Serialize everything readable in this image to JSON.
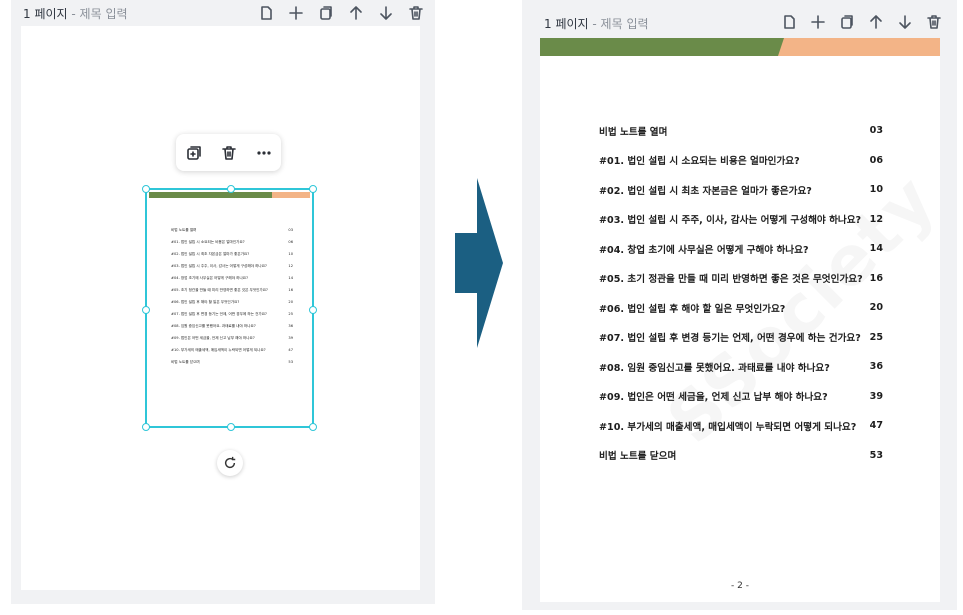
{
  "left": {
    "page_label": "1 페이지",
    "page_label_sep": " - ",
    "page_title_placeholder": "제목 입력",
    "toolbar_icons": [
      "page-icon",
      "add-icon",
      "duplicate-icon",
      "arrow-up-icon",
      "arrow-down-icon",
      "trash-icon"
    ],
    "context_toolbar_icons": [
      "duplicate-plus-icon",
      "trash-icon",
      "more-icon"
    ],
    "mini_toc": [
      {
        "title": "비법 노트를 열며",
        "page": "03"
      },
      {
        "title": "#01. 법인 설립 시 소요되는 비용은 얼마인가요?",
        "page": "06"
      },
      {
        "title": "#02. 법인 설립 시 최초 자본금은 얼마가 좋은가요?",
        "page": "10"
      },
      {
        "title": "#03. 법인 설립 시 주주, 이사, 감사는 어떻게 구성해야 하나요?",
        "page": "12"
      },
      {
        "title": "#04. 창업 초기에 사무실은 어떻게 구해야 하나요?",
        "page": "14"
      },
      {
        "title": "#05. 초기 정관을 만들 때 미리 반영하면 좋은 것은 무엇인가요?",
        "page": "16"
      },
      {
        "title": "#06. 법인 설립 후 해야 할 일은 무엇인가요?",
        "page": "20"
      },
      {
        "title": "#07. 법인 설립 후 변경 등기는 언제, 어떤 경우에 하는 건가요?",
        "page": "25"
      },
      {
        "title": "#08. 임원 중임신고를 못했어요. 과태료를 내야 하나요?",
        "page": "36"
      },
      {
        "title": "#09. 법인은 어떤 세금을, 언제 신고 납부 해야 하나요?",
        "page": "39"
      },
      {
        "title": "#10. 부가세의 매출세액, 매입세액이 누락되면 어떻게 되나요?",
        "page": "47"
      },
      {
        "title": "비법 노트를 닫으며",
        "page": "53"
      }
    ]
  },
  "right": {
    "page_label": "1 페이지",
    "page_label_sep": " - ",
    "page_title_placeholder": "제목 입력",
    "toolbar_icons": [
      "page-icon",
      "add-icon",
      "duplicate-icon",
      "arrow-up-icon",
      "arrow-down-icon",
      "trash-icon"
    ],
    "toc": [
      {
        "title": "비법 노트를 열며",
        "page": "03"
      },
      {
        "title": "#01. 법인 설립 시 소요되는 비용은 얼마인가요?",
        "page": "06"
      },
      {
        "title": "#02. 법인 설립 시 최초 자본금은 얼마가 좋은가요?",
        "page": "10"
      },
      {
        "title": "#03. 법인 설립 시 주주, 이사, 감사는 어떻게 구성해야 하나요?",
        "page": "12"
      },
      {
        "title": "#04. 창업 초기에 사무실은 어떻게 구해야 하나요?",
        "page": "14"
      },
      {
        "title": "#05. 초기 정관을 만들 때 미리 반영하면 좋은 것은 무엇인가요?",
        "page": "16"
      },
      {
        "title": "#06. 법인 설립 후 해야 할 일은 무엇인가요?",
        "page": "20"
      },
      {
        "title": "#07. 법인 설립 후 변경 등기는 언제, 어떤 경우에 하는 건가요?",
        "page": "25"
      },
      {
        "title": "#08. 임원 중임신고를 못했어요. 과태료를 내야 하나요?",
        "page": "36"
      },
      {
        "title": "#09. 법인은 어떤 세금을, 언제 신고 납부 해야 하나요?",
        "page": "39"
      },
      {
        "title": "#10. 부가세의 매출세액, 매입세액이 누락되면 어떻게 되나요?",
        "page": "47"
      },
      {
        "title": "비법 노트를 닫으며",
        "page": "53"
      }
    ],
    "watermark": "SSociety",
    "page_number": "- 2 -"
  },
  "colors": {
    "band_green": "#6a8b49",
    "band_peach": "#f3b487",
    "selection": "#2fc6d8",
    "arrow": "#1b5f82"
  }
}
